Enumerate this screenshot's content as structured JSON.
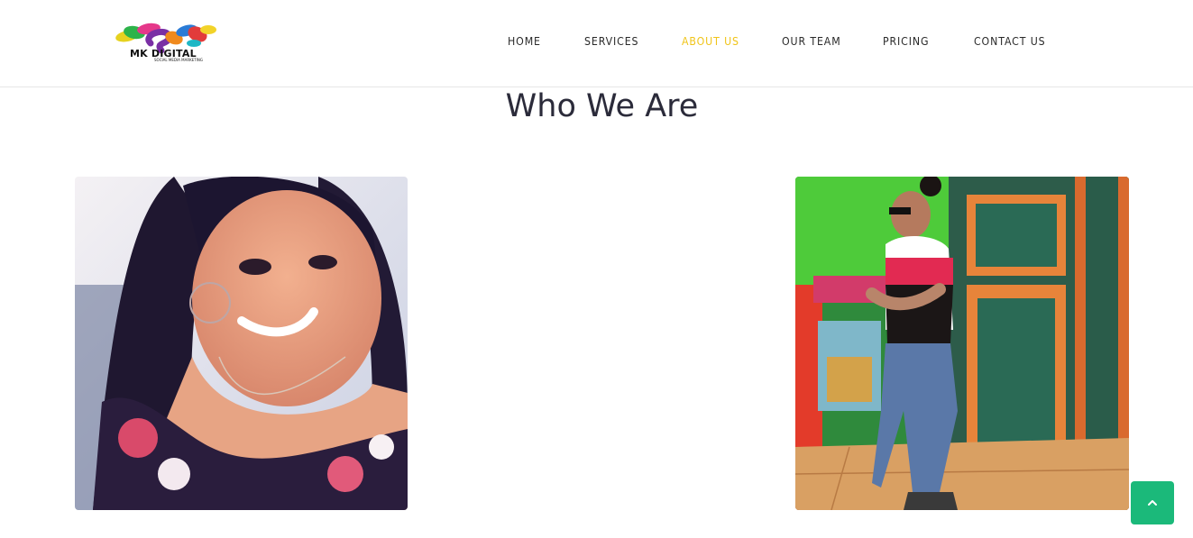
{
  "header": {
    "logo": {
      "text": "MK DIGITAL",
      "subtext": "SOCIAL MEDIA MARKETING",
      "icon": "colorful-swirl-logo-icon"
    },
    "nav": [
      {
        "label": "HOME",
        "active": false
      },
      {
        "label": "SERVICES",
        "active": false
      },
      {
        "label": "ABOUT US",
        "active": true
      },
      {
        "label": "OUR TEAM",
        "active": false
      },
      {
        "label": "PRICING",
        "active": false
      },
      {
        "label": "CONTACT US",
        "active": false
      }
    ],
    "active_color": "#f0c419"
  },
  "section": {
    "title": "Who We Are",
    "photos": [
      {
        "description_icon": "team-member-portrait-1-icon"
      },
      {
        "description_icon": "team-member-portrait-2-icon"
      }
    ]
  },
  "back_to_top": {
    "icon": "chevron-up-icon",
    "color": "#1bb97a"
  }
}
